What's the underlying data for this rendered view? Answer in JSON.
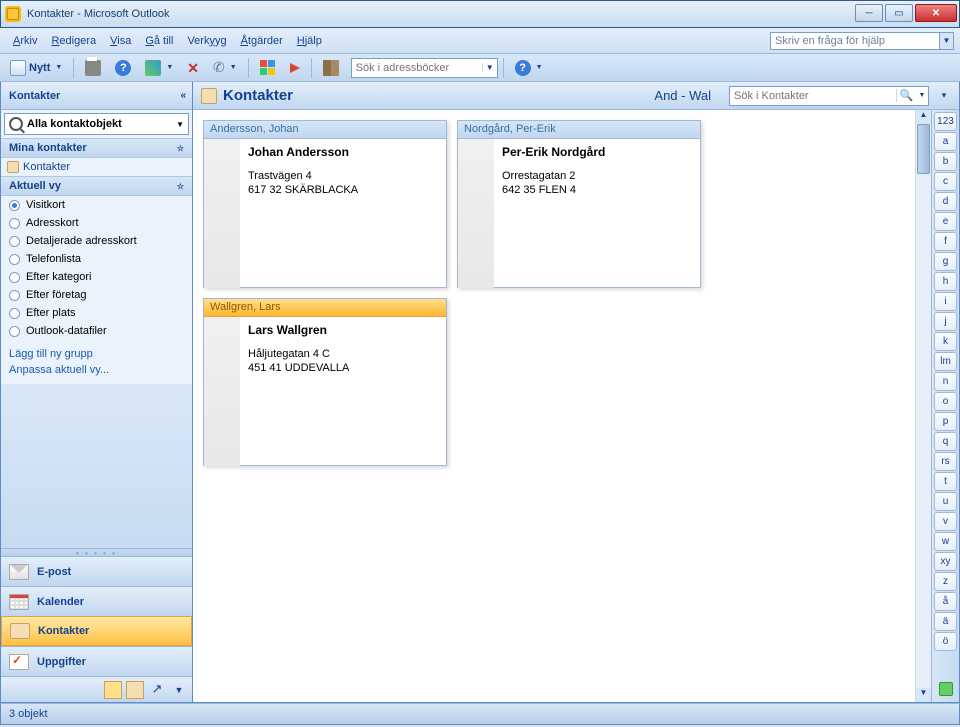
{
  "window": {
    "title": "Kontakter - Microsoft Outlook"
  },
  "menu": {
    "arkiv": "Arkiv",
    "redigera": "Redigera",
    "visa": "Visa",
    "gatill": "Gå till",
    "verktyg": "Verktyg",
    "atgarder": "Åtgärder",
    "hjalp": "Hjälp",
    "help_placeholder": "Skriv en fråga för hjälp"
  },
  "toolbar": {
    "new_label": "Nytt",
    "addrsearch_placeholder": "Sök i adressböcker"
  },
  "nav": {
    "header": "Kontakter",
    "all_objects": "Alla kontaktobjekt",
    "my_contacts": "Mina kontakter",
    "contacts_item": "Kontakter",
    "current_view": "Aktuell vy",
    "views": [
      "Visitkort",
      "Adresskort",
      "Detaljerade adresskort",
      "Telefonlista",
      "Efter kategori",
      "Efter företag",
      "Efter plats",
      "Outlook-datafiler"
    ],
    "selected_view": 0,
    "link_add_group": "Lägg till ny grupp",
    "link_customize": "Anpassa aktuell vy...",
    "big": {
      "mail": "E-post",
      "calendar": "Kalender",
      "contacts": "Kontakter",
      "tasks": "Uppgifter"
    }
  },
  "content": {
    "title": "Kontakter",
    "range": "And - Wal",
    "search_placeholder": "Sök i Kontakter"
  },
  "cards": [
    {
      "header": "Andersson, Johan",
      "name": "Johan Andersson",
      "line1": "Trastvägen 4",
      "line2": "617 32 SKÄRBLACKA",
      "selected": false
    },
    {
      "header": "Nordgård, Per-Erik",
      "name": "Per-Erik Nordgård",
      "line1": "Orrestagatan 2",
      "line2": "642 35 FLEN 4",
      "selected": false
    },
    {
      "header": "Wallgren, Lars",
      "name": "Lars Wallgren",
      "line1": "Håljutegatan 4 C",
      "line2": "451 41 UDDEVALLA",
      "selected": true
    }
  ],
  "alpha": [
    "123",
    "a",
    "b",
    "c",
    "d",
    "e",
    "f",
    "g",
    "h",
    "i",
    "j",
    "k",
    "lm",
    "n",
    "o",
    "p",
    "q",
    "rs",
    "t",
    "u",
    "v",
    "w",
    "xy",
    "z",
    "å",
    "ä",
    "ö"
  ],
  "status": {
    "count": "3 objekt"
  }
}
